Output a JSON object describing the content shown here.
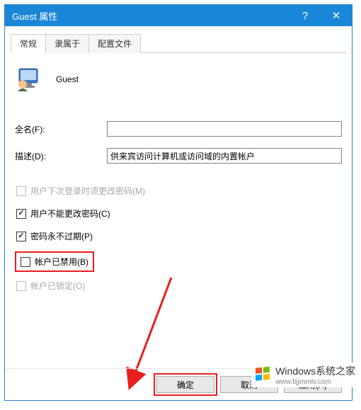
{
  "titlebar": {
    "title": "Guest 属性",
    "help": "?",
    "close": "✕"
  },
  "tabs": {
    "t0": "常规",
    "t1": "隶属于",
    "t2": "配置文件"
  },
  "user": {
    "name": "Guest"
  },
  "fields": {
    "fullname_label": "全名(F):",
    "fullname_value": "",
    "desc_label": "描述(D):",
    "desc_value": "供来宾访问计算机或访问域的内置帐户"
  },
  "checks": {
    "c1": "用户下次登录时须更改密码(M)",
    "c2": "用户不能更改密码(C)",
    "c3": "密码永不过期(P)",
    "c4": "帐户已禁用(B)",
    "c5": "帐户已锁定(O)"
  },
  "buttons": {
    "ok": "确定",
    "cancel": "取消",
    "apply": "应用(A)"
  },
  "watermark": {
    "line1": "Windows系统之家",
    "line2": "www.bjjmmlv.com"
  }
}
